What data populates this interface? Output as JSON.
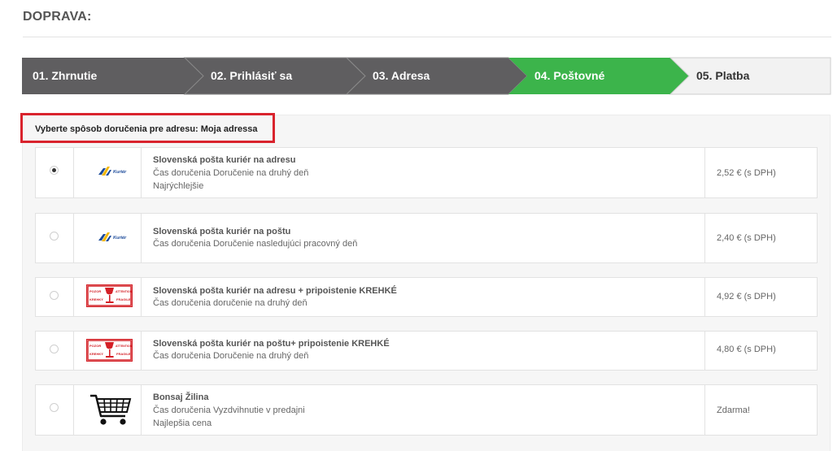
{
  "page": {
    "title": "DOPRAVA:"
  },
  "steps": [
    {
      "label": "01. Zhrnutie",
      "state": "done"
    },
    {
      "label": "02. Prihlásiť sa",
      "state": "done"
    },
    {
      "label": "03. Adresa",
      "state": "done"
    },
    {
      "label": "04. Poštovné",
      "state": "active"
    },
    {
      "label": "05. Platba",
      "state": "pending"
    }
  ],
  "colors": {
    "step_done": "#5f5e60",
    "step_active": "#3cb44b",
    "step_pending": "#f2f2f2",
    "highlight_border": "#d9232d"
  },
  "shipping": {
    "header": "Vyberte spôsob doručenia pre adresu: Moja adressa",
    "options": [
      {
        "name": "Slovenská pošta kuriér na adresu",
        "time": "Čas doručenia Doručenie na druhý deň",
        "note": "Najrýchlejšie",
        "price": "2,52 € (s DPH)",
        "selected": true,
        "logo": "kurier-logo",
        "logo_text": "Kuriér"
      },
      {
        "name": "Slovenská pošta kuriér na poštu",
        "time": "Čas doručenia Doručenie nasledujúci pracovný deň",
        "note": "",
        "price": "2,40 € (s DPH)",
        "selected": false,
        "logo": "kurier-logo",
        "logo_text": "Kuriér"
      },
      {
        "name": "Slovenská pošta kuriér na adresu + pripoistenie KREHKÉ",
        "time": "Čas doručenia doručenie na druhý deň",
        "note": "",
        "price": "4,92 € (s DPH)",
        "selected": false,
        "logo": "fragile-label-icon",
        "logo_text": [
          "POZOR",
          "KREHKÝ",
          "ATTENTION",
          "FRAGILE"
        ]
      },
      {
        "name": "Slovenská pošta kuriér na poštu+ pripoistenie KREHKÉ",
        "time": "Čas doručenia Doručenie na druhý deň",
        "note": "",
        "price": "4,80 € (s DPH)",
        "selected": false,
        "logo": "fragile-label-icon",
        "logo_text": [
          "POZOR",
          "KREHKÝ",
          "ATTENTION",
          "FRAGILE"
        ]
      },
      {
        "name": "Bonsaj Žilina",
        "time": "Čas doručenia Vyzdvihnutie v predajni",
        "note": "Najlepšia cena",
        "price": "Zdarma!",
        "selected": false,
        "logo": "shopping-cart-icon"
      }
    ]
  }
}
